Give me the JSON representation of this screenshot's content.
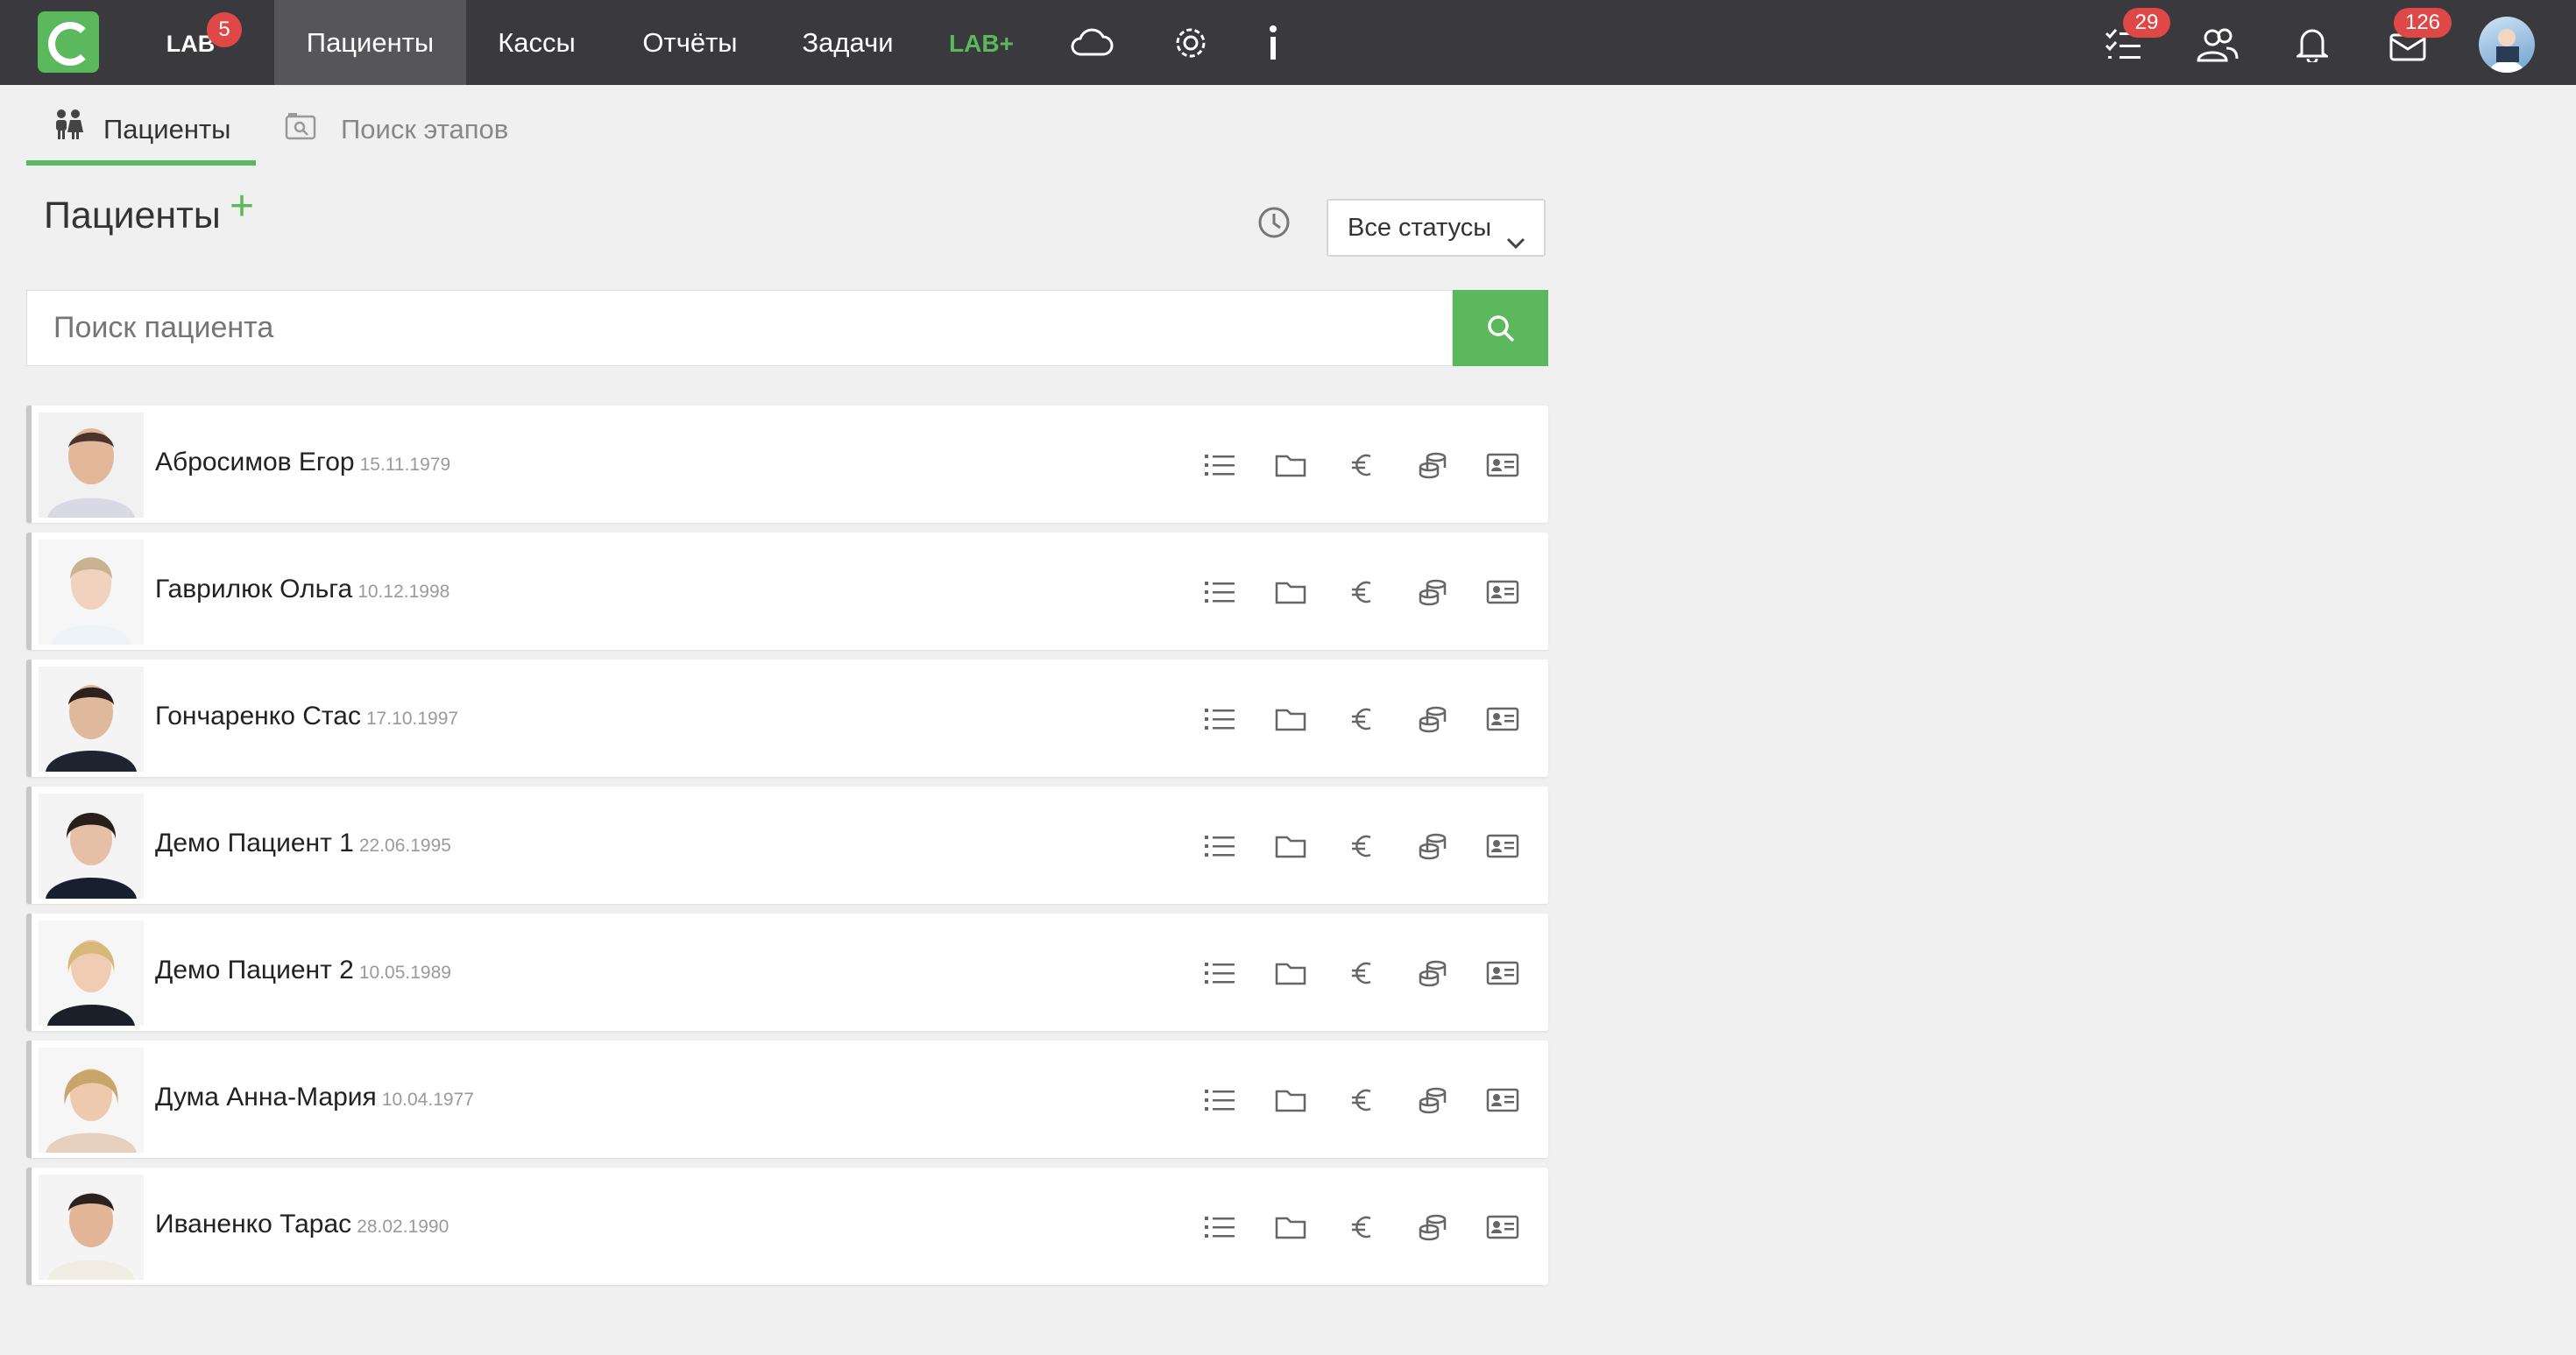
{
  "nav": {
    "lab_label": "LAB",
    "lab_badge": "5",
    "items": [
      {
        "label": "Пациенты",
        "active": true
      },
      {
        "label": "Кассы",
        "active": false
      },
      {
        "label": "Отчёты",
        "active": false
      },
      {
        "label": "Задачи",
        "active": false
      }
    ],
    "lab_plus_label": "LAB+",
    "icons": [
      "cloud-icon",
      "gear-icon",
      "info-icon"
    ],
    "right": {
      "tasks_badge": "29",
      "messages_badge": "126",
      "icons": [
        "task-list-icon",
        "users-icon",
        "bell-icon",
        "mail-icon",
        "user-avatar"
      ]
    }
  },
  "subtabs": [
    {
      "label": "Пациенты",
      "icon": "patients-icon",
      "active": true
    },
    {
      "label": "Поиск этапов",
      "icon": "stage-search-icon",
      "active": false
    }
  ],
  "page": {
    "title": "Пациенты",
    "add_symbol": "+",
    "status_filter": "Все статусы"
  },
  "search": {
    "placeholder": "Поиск пациента"
  },
  "patients": [
    {
      "name": "Абросимов Егор",
      "dob": "15.11.1979"
    },
    {
      "name": "Гаврилюк Ольга",
      "dob": "10.12.1998"
    },
    {
      "name": "Гончаренко Стас",
      "dob": "17.10.1997"
    },
    {
      "name": "Демо Пациент 1",
      "dob": "22.06.1995"
    },
    {
      "name": "Демо Пациент 2",
      "dob": "10.05.1989"
    },
    {
      "name": "Дума Анна-Мария",
      "dob": "10.04.1977"
    },
    {
      "name": "Иваненко Тарас",
      "dob": "28.02.1990"
    }
  ],
  "row_actions": [
    "treatment-list-icon",
    "folder-icon",
    "euro-icon",
    "coins-icon",
    "id-card-icon"
  ],
  "colors": {
    "accent": "#5cb85c",
    "topbar": "#3a3a3e",
    "badge": "#e04848",
    "background": "#f0f0f0"
  }
}
